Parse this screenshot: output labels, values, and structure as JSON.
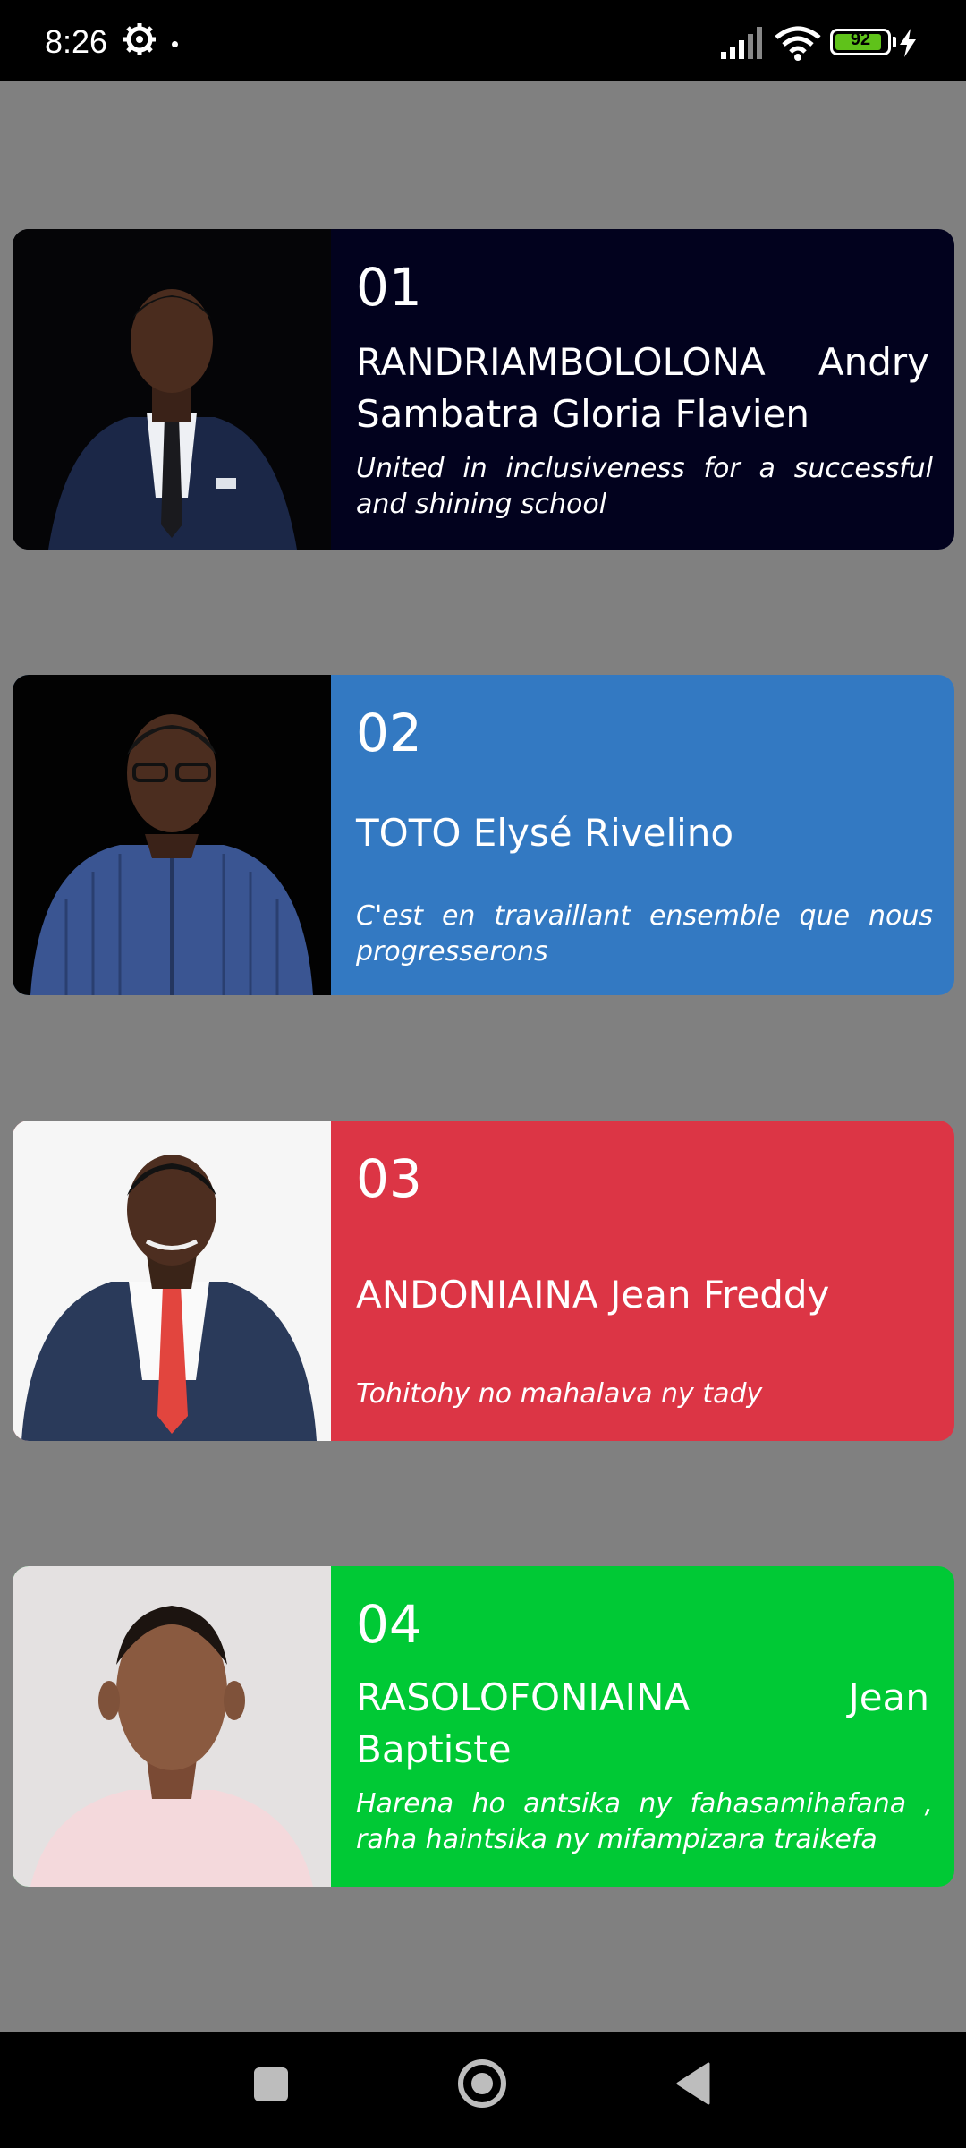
{
  "status_bar": {
    "time": "8:26",
    "battery": "92",
    "icons": [
      "gear-icon",
      "signal-icon",
      "wifi-icon",
      "battery-icon",
      "charging-bolt-icon"
    ]
  },
  "colors": {
    "background": "#808080",
    "card1": "#02021e",
    "card2": "#3379c2",
    "card3": "#dc3545",
    "card4": "#00c935"
  },
  "cards": [
    {
      "number": "01",
      "name": "RANDRIAMBOLOLONA Andry Sambatra Gloria Flavien",
      "slogan": "United in inclusiveness for a successful and shining school"
    },
    {
      "number": "02",
      "name": "TOTO Elysé Rivelino",
      "slogan": "C'est en travaillant ensemble que nous progresserons"
    },
    {
      "number": "03",
      "name": "ANDONIAINA Jean Freddy",
      "slogan": "Tohitohy no mahalava ny tady"
    },
    {
      "number": "04",
      "name": "RASOLOFONIAINA Jean Baptiste",
      "slogan": "Harena ho antsika ny fahasamihafana , raha haintsika ny mifampizara traikefa"
    }
  ],
  "nav_bar": {
    "icons": [
      "recent-apps-icon",
      "home-icon",
      "back-icon"
    ]
  }
}
